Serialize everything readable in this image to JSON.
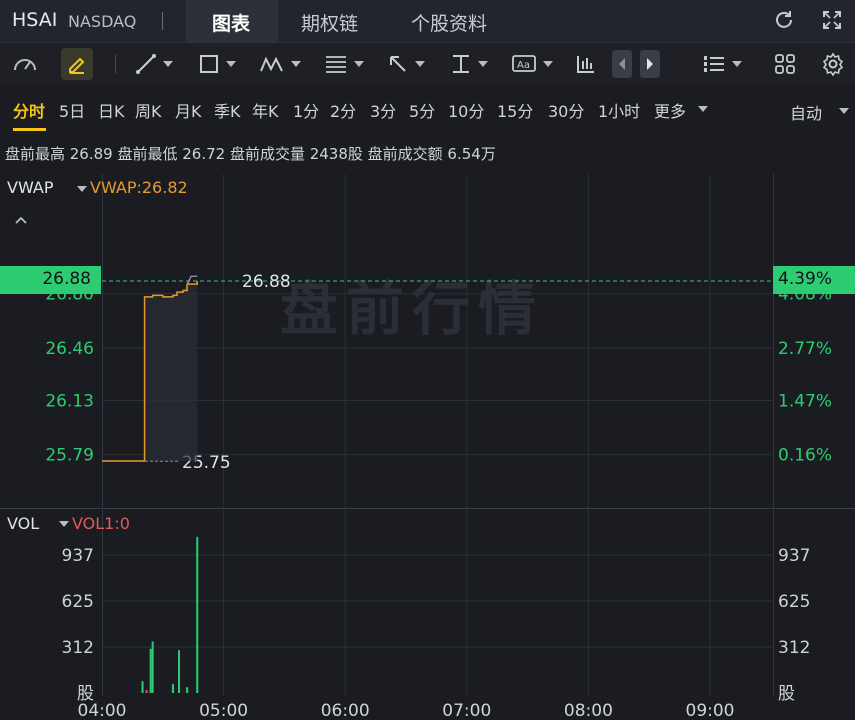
{
  "header": {
    "ticker": "HSAI",
    "exchange": "NASDAQ",
    "tabs": [
      "图表",
      "期权链",
      "个股资料"
    ]
  },
  "toolbar": {
    "tools": [
      "gauge-icon",
      "draw-pen-icon",
      "line-icon",
      "rect-icon",
      "pattern-icon",
      "fib-icon",
      "arrow-icon",
      "measure-icon",
      "text-icon",
      "indicator-icon",
      "prev-arrow-icon",
      "next-arrow-icon",
      "layout-list-icon",
      "grid-icon",
      "gear-icon"
    ]
  },
  "periods": {
    "items": [
      "分时",
      "5日",
      "日K",
      "周K",
      "月K",
      "季K",
      "年K",
      "1分",
      "2分",
      "3分",
      "5分",
      "10分",
      "15分",
      "30分",
      "1小时",
      "更多"
    ],
    "active": "分时",
    "auto": "自动"
  },
  "stats": {
    "text": "盘前最高 26.89  盘前最低 26.72  盘前成交量 2438股  盘前成交额 6.54万"
  },
  "price_panel": {
    "indicator": "VWAP",
    "indicator_value": "VWAP:26.82",
    "watermark": "盘前行情",
    "last_price": "26.88",
    "last_pct": "4.39%",
    "line_label": "26.88",
    "prev_close_label": "25.75",
    "left_ticks": [
      "26.80",
      "26.46",
      "26.13",
      "25.79"
    ],
    "right_ticks": [
      "4.08%",
      "2.77%",
      "1.47%",
      "0.16%"
    ],
    "colors": {
      "up": "#2ecc71",
      "line": "#e89a2c",
      "vwap": "#e89a2c"
    }
  },
  "volume_panel": {
    "indicator": "VOL",
    "indicator_value": "VOL1:0",
    "ticks": [
      "937",
      "625",
      "312",
      "股"
    ]
  },
  "x_axis": [
    "04:00",
    "05:00",
    "06:00",
    "07:00",
    "08:00",
    "09:00"
  ],
  "chart_data": {
    "type": "line",
    "x": [
      "04:00",
      "04:20",
      "04:21",
      "04:25",
      "04:30",
      "04:35",
      "04:37",
      "04:40",
      "04:42",
      "04:45",
      "04:47"
    ],
    "price": [
      25.75,
      25.75,
      26.78,
      26.79,
      26.78,
      26.79,
      26.81,
      26.82,
      26.86,
      26.86,
      26.88
    ],
    "ylim": [
      25.75,
      26.95
    ],
    "volume_ylim": [
      0,
      1100
    ],
    "volume": [
      {
        "x": "04:20",
        "v": 80,
        "dir": "up"
      },
      {
        "x": "04:22",
        "v": 20,
        "dir": "down"
      },
      {
        "x": "04:24",
        "v": 300,
        "dir": "up"
      },
      {
        "x": "04:25",
        "v": 350,
        "dir": "up"
      },
      {
        "x": "04:35",
        "v": 60,
        "dir": "up"
      },
      {
        "x": "04:38",
        "v": 290,
        "dir": "up"
      },
      {
        "x": "04:42",
        "v": 40,
        "dir": "up"
      },
      {
        "x": "04:47",
        "v": 1060,
        "dir": "up"
      }
    ]
  }
}
